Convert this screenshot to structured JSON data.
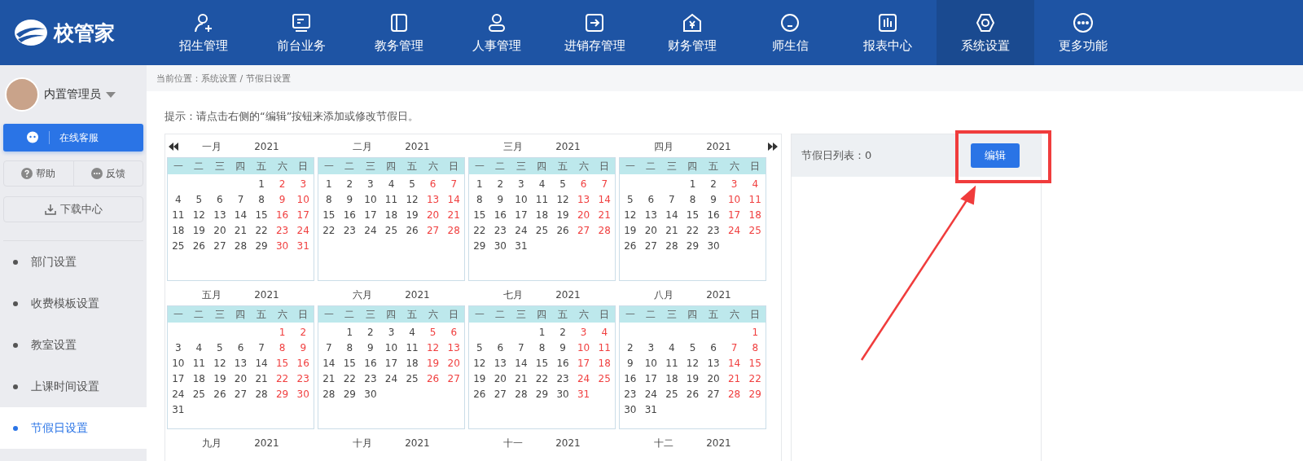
{
  "logo": {
    "text": "校管家"
  },
  "nav": [
    {
      "label": "招生管理",
      "selected": false
    },
    {
      "label": "前台业务",
      "selected": false
    },
    {
      "label": "教务管理",
      "selected": false
    },
    {
      "label": "人事管理",
      "selected": false
    },
    {
      "label": "进销存管理",
      "selected": false
    },
    {
      "label": "财务管理",
      "selected": false
    },
    {
      "label": "师生信",
      "selected": false
    },
    {
      "label": "报表中心",
      "selected": false
    },
    {
      "label": "系统设置",
      "selected": true
    },
    {
      "label": "更多功能",
      "selected": false
    }
  ],
  "user": {
    "name": "内置管理员"
  },
  "sidebar": {
    "service_button": "在线客服",
    "help": "帮助",
    "feedback": "反馈",
    "download": "下载中心",
    "items": [
      {
        "label": "部门设置",
        "selected": false
      },
      {
        "label": "收费模板设置",
        "selected": false
      },
      {
        "label": "教室设置",
        "selected": false
      },
      {
        "label": "上课时间设置",
        "selected": false
      },
      {
        "label": "节假日设置",
        "selected": true
      }
    ]
  },
  "breadcrumb": "当前位置：系统设置 / 节假日设置",
  "hint": "提示：请点击右侧的“编辑”按钮来添加或修改节假日。",
  "calendar": {
    "months": [
      {
        "name": "一月",
        "year": "2021",
        "weekdays": [
          "一",
          "二",
          "三",
          "四",
          "五",
          "六",
          "日"
        ],
        "weeks": [
          [
            "1",
            "2",
            "3"
          ],
          [
            "4",
            "5",
            "6",
            "7",
            "8",
            "9",
            "10"
          ],
          [
            "11",
            "12",
            "13",
            "14",
            "15",
            "16",
            "17"
          ],
          [
            "18",
            "19",
            "20",
            "21",
            "22",
            "23",
            "24"
          ],
          [
            "25",
            "26",
            "27",
            "28",
            "29",
            "30",
            "31"
          ]
        ]
      },
      {
        "name": "二月",
        "year": "2021",
        "weekdays": [
          "一",
          "二",
          "三",
          "四",
          "五",
          "六",
          "日"
        ],
        "weeks": [
          [
            "1",
            "2",
            "3",
            "4",
            "5",
            "6",
            "7"
          ],
          [
            "8",
            "9",
            "10",
            "11",
            "12",
            "13",
            "14"
          ],
          [
            "15",
            "16",
            "17",
            "18",
            "19",
            "20",
            "21"
          ],
          [
            "22",
            "23",
            "24",
            "25",
            "26",
            "27",
            "28"
          ]
        ]
      },
      {
        "name": "三月",
        "year": "2021",
        "weekdays": [
          "一",
          "二",
          "三",
          "四",
          "五",
          "六",
          "日"
        ],
        "weeks": [
          [
            "1",
            "2",
            "3",
            "4",
            "5",
            "6",
            "7"
          ],
          [
            "8",
            "9",
            "10",
            "11",
            "12",
            "13",
            "14"
          ],
          [
            "15",
            "16",
            "17",
            "18",
            "19",
            "20",
            "21"
          ],
          [
            "22",
            "23",
            "24",
            "25",
            "26",
            "27",
            "28"
          ],
          [
            "29",
            "30",
            "31"
          ]
        ]
      },
      {
        "name": "四月",
        "year": "2021",
        "weekdays": [
          "一",
          "二",
          "三",
          "四",
          "五",
          "六",
          "日"
        ],
        "weeks": [
          [
            "1",
            "2",
            "3",
            "4"
          ],
          [
            "5",
            "6",
            "7",
            "8",
            "9",
            "10",
            "11"
          ],
          [
            "12",
            "13",
            "14",
            "15",
            "16",
            "17",
            "18"
          ],
          [
            "19",
            "20",
            "21",
            "22",
            "23",
            "24",
            "25"
          ],
          [
            "26",
            "27",
            "28",
            "29",
            "30"
          ]
        ]
      },
      {
        "name": "五月",
        "year": "2021",
        "weekdays": [
          "一",
          "二",
          "三",
          "四",
          "五",
          "六",
          "日"
        ],
        "weeks": [
          [
            "1",
            "2"
          ],
          [
            "3",
            "4",
            "5",
            "6",
            "7",
            "8",
            "9"
          ],
          [
            "10",
            "11",
            "12",
            "13",
            "14",
            "15",
            "16"
          ],
          [
            "17",
            "18",
            "19",
            "20",
            "21",
            "22",
            "23"
          ],
          [
            "24",
            "25",
            "26",
            "27",
            "28",
            "29",
            "30"
          ],
          [
            "31"
          ]
        ]
      },
      {
        "name": "六月",
        "year": "2021",
        "weekdays": [
          "一",
          "二",
          "三",
          "四",
          "五",
          "六",
          "日"
        ],
        "weeks": [
          [
            "1",
            "2",
            "3",
            "4",
            "5",
            "6"
          ],
          [
            "7",
            "8",
            "9",
            "10",
            "11",
            "12",
            "13"
          ],
          [
            "14",
            "15",
            "16",
            "17",
            "18",
            "19",
            "20"
          ],
          [
            "21",
            "22",
            "23",
            "24",
            "25",
            "26",
            "27"
          ],
          [
            "28",
            "29",
            "30"
          ]
        ]
      },
      {
        "name": "七月",
        "year": "2021",
        "weekdays": [
          "一",
          "二",
          "三",
          "四",
          "五",
          "六",
          "日"
        ],
        "weeks": [
          [
            "1",
            "2",
            "3",
            "4"
          ],
          [
            "5",
            "6",
            "7",
            "8",
            "9",
            "10",
            "11"
          ],
          [
            "12",
            "13",
            "14",
            "15",
            "16",
            "17",
            "18"
          ],
          [
            "19",
            "20",
            "21",
            "22",
            "23",
            "24",
            "25"
          ],
          [
            "26",
            "27",
            "28",
            "29",
            "30",
            "31"
          ]
        ]
      },
      {
        "name": "八月",
        "year": "2021",
        "weekdays": [
          "一",
          "二",
          "三",
          "四",
          "五",
          "六",
          "日"
        ],
        "weeks": [
          [
            "1"
          ],
          [
            "2",
            "3",
            "4",
            "5",
            "6",
            "7",
            "8"
          ],
          [
            "9",
            "10",
            "11",
            "12",
            "13",
            "14",
            "15"
          ],
          [
            "16",
            "17",
            "18",
            "19",
            "20",
            "21",
            "22"
          ],
          [
            "23",
            "24",
            "25",
            "26",
            "27",
            "28",
            "29"
          ],
          [
            "30",
            "31"
          ]
        ]
      },
      {
        "name": "九月",
        "year": "2021"
      },
      {
        "name": "十月",
        "year": "2021"
      },
      {
        "name": "十一",
        "year": "2021"
      },
      {
        "name": "十二",
        "year": "2021"
      }
    ]
  },
  "holiday_panel": {
    "title": "节假日列表：0",
    "edit_button": "编辑"
  }
}
